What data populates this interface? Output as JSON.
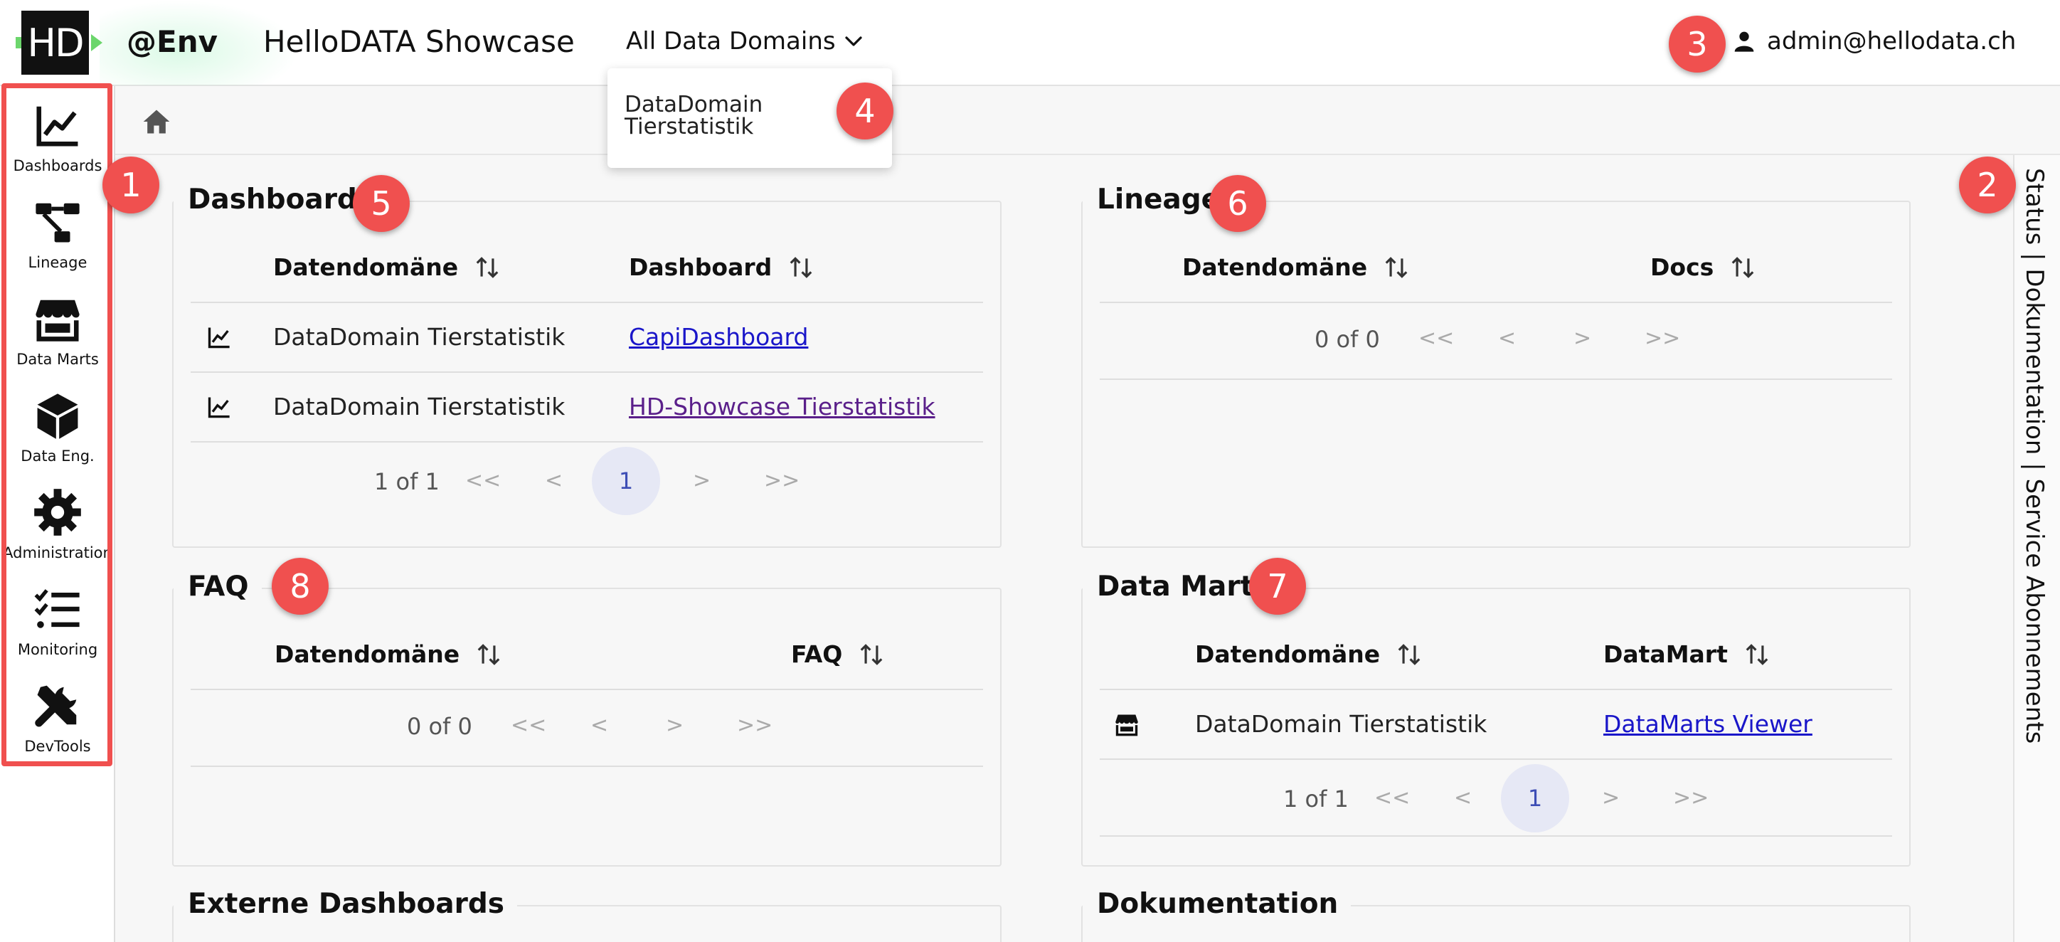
{
  "header": {
    "logo": "HD",
    "env": "@Env",
    "title": "HelloDATA Showcase",
    "domain_select": "All Data Domains",
    "user": "admin@hellodata.ch"
  },
  "dropdown": {
    "option": "DataDomain Tierstatistik"
  },
  "sidebar": {
    "items": [
      {
        "label": "Dashboards",
        "icon": "chart-line-icon"
      },
      {
        "label": "Lineage",
        "icon": "lineage-icon"
      },
      {
        "label": "Data Marts",
        "icon": "store-icon"
      },
      {
        "label": "Data Eng.",
        "icon": "cube-icon"
      },
      {
        "label": "Administration",
        "icon": "gear-icon"
      },
      {
        "label": "Monitoring",
        "icon": "checklist-icon"
      },
      {
        "label": "DevTools",
        "icon": "tools-icon"
      }
    ]
  },
  "status_strip": "Status | Dokumentation | Service Abonnements",
  "cards": {
    "dashboards": {
      "title": "Dashboards",
      "col1": "Datendomäne",
      "col2": "Dashboard",
      "rows": [
        {
          "domain": "DataDomain Tierstatistik",
          "link": "CapiDashboard"
        },
        {
          "domain": "DataDomain Tierstatistik",
          "link": "HD-Showcase Tierstatistik"
        }
      ],
      "pager": {
        "info": "1 of 1",
        "first": "<<",
        "prev": "<",
        "page": "1",
        "next": ">",
        "last": ">>"
      }
    },
    "lineage": {
      "title": "Lineage",
      "col1": "Datendomäne",
      "col2": "Docs",
      "pager": {
        "info": "0 of 0",
        "first": "<<",
        "prev": "<",
        "next": ">",
        "last": ">>"
      }
    },
    "faq": {
      "title": "FAQ",
      "col1": "Datendomäne",
      "col2": "FAQ",
      "pager": {
        "info": "0 of 0",
        "first": "<<",
        "prev": "<",
        "next": ">",
        "last": ">>"
      }
    },
    "datamarts": {
      "title": "Data Marts",
      "col1": "Datendomäne",
      "col2": "DataMart",
      "rows": [
        {
          "domain": "DataDomain Tierstatistik",
          "link": "DataMarts Viewer"
        }
      ],
      "pager": {
        "info": "1 of 1",
        "first": "<<",
        "prev": "<",
        "page": "1",
        "next": ">",
        "last": ">>"
      }
    },
    "extern": {
      "title": "Externe Dashboards"
    },
    "docs": {
      "title": "Dokumentation"
    }
  },
  "badges": [
    "1",
    "2",
    "3",
    "4",
    "5",
    "6",
    "7",
    "8"
  ],
  "colors": {
    "accent": "#f0504f",
    "link": "#1a16c9",
    "visited": "#5a1f8a",
    "page_bg": "#f7f7f7"
  }
}
